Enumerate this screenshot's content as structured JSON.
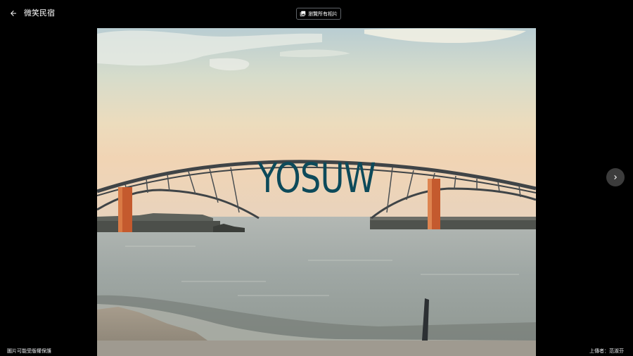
{
  "header": {
    "title": "微笑民宿",
    "gallery_button_label": "瀏覽所有相片"
  },
  "photo": {
    "watermark_text": "YOSUW",
    "alt": "微笑民宿"
  },
  "footer": {
    "copyright_notice": "圖片可能受版權保護",
    "uploader": "上傳者：范淑芬"
  },
  "icons": {
    "back": "arrow-left-icon",
    "gallery": "photo-library-icon",
    "next": "chevron-right-icon"
  },
  "colors": {
    "background": "#000000",
    "text": "#ffffff",
    "button_border": "#5f6368",
    "next_button_bg": "#3c3c3c",
    "watermark": "#0d4a5a"
  }
}
